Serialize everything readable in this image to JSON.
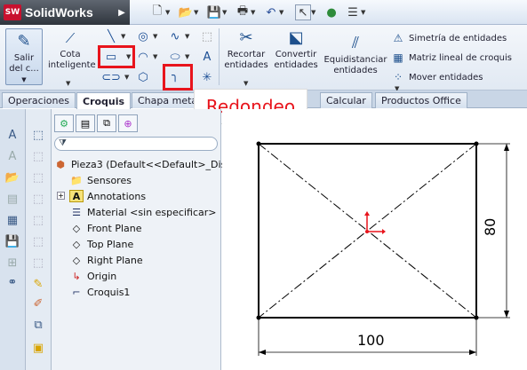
{
  "app": {
    "name": "SolidWorks",
    "logo_mark": "SW"
  },
  "quick_access": [
    {
      "name": "new-document-icon",
      "glyph": "🗋"
    },
    {
      "name": "open-icon",
      "glyph": "📂"
    },
    {
      "name": "save-icon",
      "glyph": "💾"
    },
    {
      "name": "print-icon",
      "glyph": "🖶"
    },
    {
      "name": "undo-icon",
      "glyph": "↶"
    },
    {
      "name": "select-icon",
      "glyph": "↖"
    },
    {
      "name": "rebuild-icon",
      "glyph": "🚦"
    },
    {
      "name": "options-icon",
      "glyph": "☰"
    }
  ],
  "commands": {
    "exit_sketch": {
      "line1": "Salir",
      "line2": "del c..."
    },
    "smart_dimension": {
      "line1": "Cota",
      "line2": "inteligente"
    },
    "trim": {
      "line1": "Recortar",
      "line2": "entidades"
    },
    "convert": {
      "line1": "Convertir",
      "line2": "entidades"
    },
    "offset": {
      "line1": "Equidistanciar",
      "line2": "entidades"
    },
    "mirror": "Simetría de entidades",
    "linear_pattern": "Matriz lineal de croquis",
    "move": "Mover entidades"
  },
  "tabs": [
    "Operaciones",
    "Croquis",
    "Chapa metálica",
    "Calcular",
    "Productos Office"
  ],
  "active_tab": "Croquis",
  "callout": "Redondeo",
  "tree": {
    "root": "Pieza3  (Default<<Default>_Dis",
    "items": [
      "Sensores",
      "Annotations",
      "Material <sin especificar>",
      "Front Plane",
      "Top Plane",
      "Right Plane",
      "Origin",
      "Croquis1"
    ]
  },
  "drawing": {
    "dimension_width": "100",
    "dimension_height": "80"
  },
  "colors": {
    "highlight": "#e8141c",
    "accent": "#1d4f8c",
    "origin": "#e8141c"
  }
}
